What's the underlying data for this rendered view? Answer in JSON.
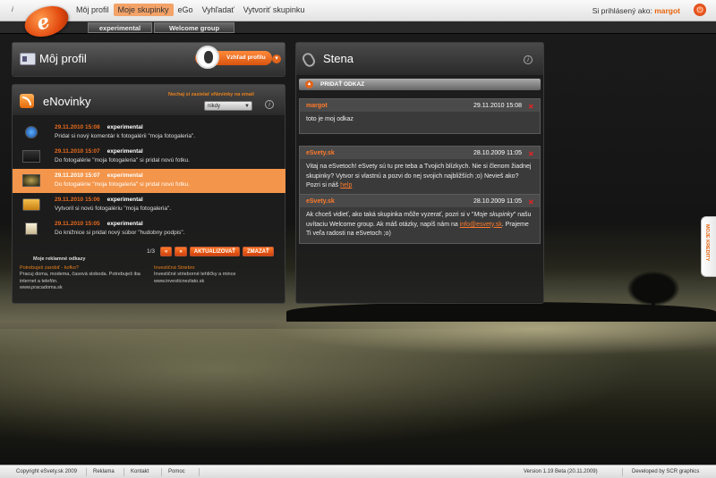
{
  "topbar": {
    "info_glyph": "i",
    "logo_letter": "e",
    "nav": [
      {
        "label": "Môj profil"
      },
      {
        "label": "Moje skupinky",
        "active": true
      },
      {
        "label": "eGo"
      },
      {
        "label": "Vyhľadať"
      },
      {
        "label": "Vytvoriť skupinku"
      }
    ],
    "logged_prefix": "Si prihlásený ako:",
    "username": "margot"
  },
  "subtabs": [
    {
      "label": "experimental"
    },
    {
      "label": "Welcome group"
    }
  ],
  "profile": {
    "title": "Môj profil",
    "look_button": "Vzhľad profilu"
  },
  "enovinky": {
    "title": "eNovinky",
    "subscribe_label": "Nechaj si zasielať eNovinky na email",
    "frequency": "nikdy",
    "items": [
      {
        "date": "29.11.2010 15:08",
        "group": "experimental",
        "text": "Pridal si nový komentár k fotogalérii \"moja fotogaleria\".",
        "highlight": false
      },
      {
        "date": "29.11.2010 15:07",
        "group": "experimental",
        "text": "Do fotogalérie \"moja fotogaleria\" si pridal novú fotku.",
        "highlight": false
      },
      {
        "date": "29.11.2010 15:07",
        "group": "experimental",
        "text": "Do fotogalérie \"moja fotogaleria\" si pridal novú fotku.",
        "highlight": true
      },
      {
        "date": "29.11.2010 15:06",
        "group": "experimental",
        "text": "Vytvoril si novú fotogalériu \"moja fotogaleria\".",
        "highlight": false
      },
      {
        "date": "29.11.2010 15:05",
        "group": "experimental",
        "text": "Do knižnice si pridal nový súbor \"hudobny podpis\".",
        "highlight": false
      }
    ],
    "pager": "1/3",
    "prev": "«",
    "next": "»",
    "refresh": "AKTUALIZOVAŤ",
    "delete": "ZMAZAŤ",
    "ads_heading": "Moje reklamné odkazy",
    "ads": [
      {
        "title": "Potrebuješ zarobiť - kofko?",
        "text": "Pracuj doma, modema, časová sloboda. Potrebuješ iba internet a telefón.",
        "url": "www.pracadoma.sk"
      },
      {
        "title": "Investičná Striebro",
        "text": "Investičné strieborné tehličky a mince",
        "url": "www.investicnezlato.sk"
      }
    ]
  },
  "stena": {
    "title": "Stena",
    "add_label": "PRIDAŤ ODKAZ",
    "posts": [
      {
        "author": "margot",
        "date": "29.11.2010 15:08",
        "text": "toto je moj odkaz"
      },
      {
        "author": "eSvety.sk",
        "date": "28.10.2009 11:05",
        "text": "Vitaj na eSvetoch! eSvety sú tu pre teba a Tvojich blízkych. Nie si členom žiadnej skupinky? Vytvor si vlastnú a pozvi do nej svojich najbližších ;o) Nevieš ako? Pozri si náš",
        "link": "help"
      },
      {
        "author": "eSvety.sk",
        "date": "28.10.2009 11:05",
        "text_a": "Ak chceš vidieť, ako taká skupinka môže vyzerať, pozri si v \"",
        "text_em": "Moje skupinky",
        "text_b": "\" našu uvítaciu Welcome group. Ak máš otázky, napíš nám na",
        "link": "info@esvety.sk",
        "text_c": ". Prajeme Ti veľa radosti na eSvetoch ;o)"
      }
    ]
  },
  "sidetab": "MOJE KREDITY",
  "footer": {
    "copyright": "Copyright eSvety.sk 2009",
    "links": [
      "Reklama",
      "Kontakt",
      "Pomoc"
    ],
    "version": "Version 1.19 Beta (20.11.2009)",
    "developer": "Developed by SCR graphics"
  },
  "colors": {
    "accent": "#e8640c",
    "highlight_row": "#f3954a"
  }
}
